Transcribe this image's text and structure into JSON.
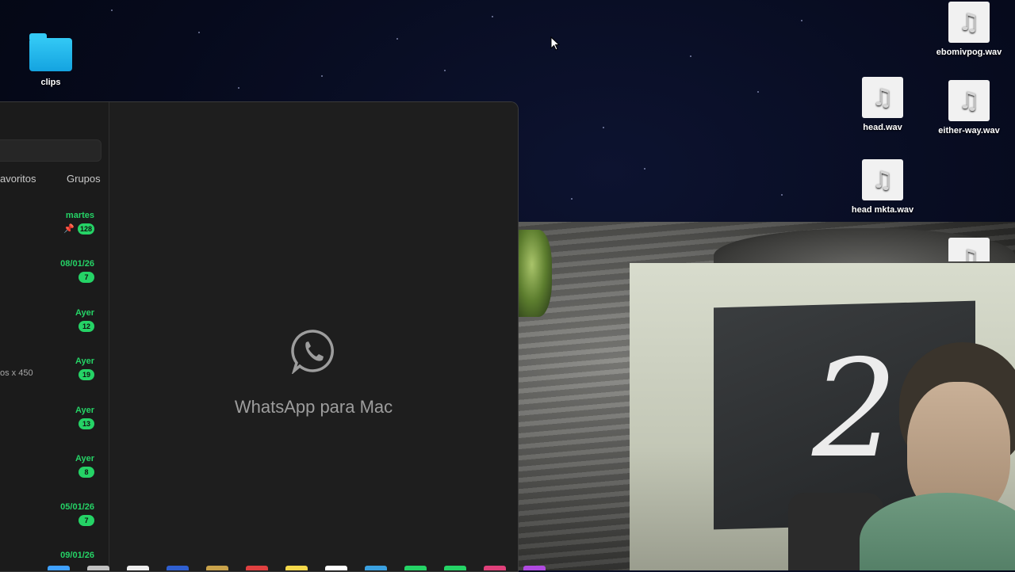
{
  "desktop": {
    "folder": {
      "label": "clips"
    },
    "files": [
      {
        "id": "ebomivpog",
        "label": "ebomivpog.wav"
      },
      {
        "id": "head",
        "label": "head.wav"
      },
      {
        "id": "either-way",
        "label": "either-way.wav"
      },
      {
        "id": "head-mkta",
        "label": "head mkta.wav"
      }
    ],
    "file_icon": "music-note-icon"
  },
  "whatsapp": {
    "tabs": [
      {
        "label": "avoritos"
      },
      {
        "label": "Grupos"
      }
    ],
    "chats": [
      {
        "date": "martes",
        "badge": "128",
        "pinned": true
      },
      {
        "date": "08/01/26",
        "badge": "7"
      },
      {
        "date": "Ayer",
        "badge": "12"
      },
      {
        "date": "Ayer",
        "badge": "19",
        "snippet": "os x 450"
      },
      {
        "date": "Ayer",
        "badge": "13"
      },
      {
        "date": "Ayer",
        "badge": "8"
      },
      {
        "date": "05/01/26",
        "badge": "7"
      },
      {
        "date": "09/01/26",
        "badge": ""
      }
    ],
    "main_title": "WhatsApp para Mac",
    "accent_color": "#25d366",
    "logo_icon": "whatsapp-logo-icon"
  },
  "webcam": {
    "description_icon": "webcam-feed"
  }
}
